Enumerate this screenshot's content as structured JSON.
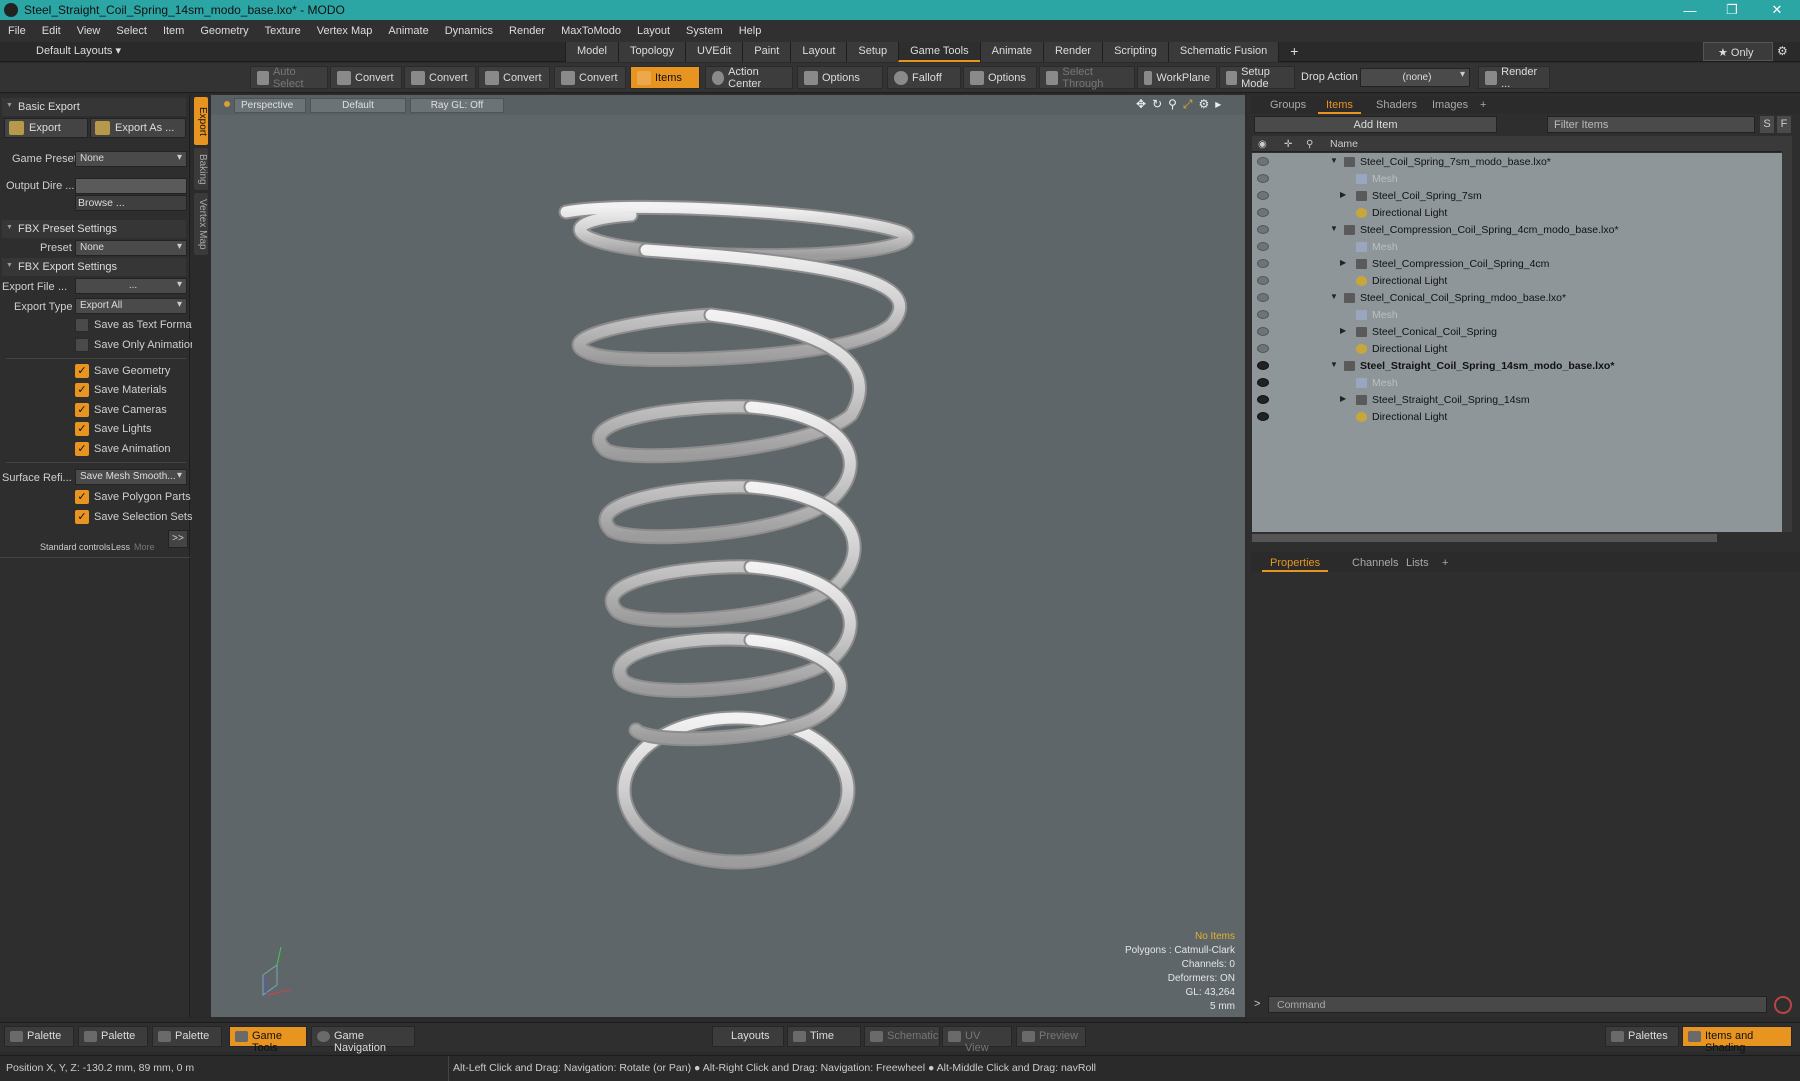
{
  "window": {
    "title": "Steel_Straight_Coil_Spring_14sm_modo_base.lxo* - MODO",
    "controls": [
      "—",
      "❐",
      "✕"
    ]
  },
  "menu": [
    "File",
    "Edit",
    "View",
    "Select",
    "Item",
    "Geometry",
    "Texture",
    "Vertex Map",
    "Animate",
    "Dynamics",
    "Render",
    "MaxToModo",
    "Layout",
    "System",
    "Help"
  ],
  "layouts": {
    "selector": "Default Layouts ▾",
    "tabs": [
      "Model",
      "Topology",
      "UVEdit",
      "Paint",
      "Layout",
      "Setup",
      "Game Tools",
      "Animate",
      "Render",
      "Scripting",
      "Schematic Fusion"
    ],
    "active": "Game Tools",
    "plus": "+",
    "only": "★  Only",
    "gear": "⚙"
  },
  "toolbar": {
    "auto_select": "Auto Select",
    "convert": "Convert",
    "items": "Items",
    "action_center": "Action Center",
    "options": "Options",
    "falloff": "Falloff",
    "select_through": "Select Through",
    "workplane": "WorkPlane",
    "setup_mode": "Setup Mode",
    "drop_action": "Drop Action",
    "drop_value": "(none)",
    "render": "Render ..."
  },
  "left": {
    "vtabs": [
      "Export",
      "Baking",
      "Vertex Map"
    ],
    "basic_export": "Basic Export",
    "export": "Export",
    "export_as": "Export As ...",
    "game_preset_label": "Game Preset",
    "game_preset": "None",
    "output_dir_label": "Output Dire ...",
    "browse": "Browse ...",
    "fbx_preset": "FBX Preset Settings",
    "preset_label": "Preset",
    "preset": "None",
    "fbx_export": "FBX Export Settings",
    "export_file_label": "Export File",
    "export_file": "...",
    "export_file_dots": "...",
    "export_type_label": "Export Type",
    "export_type": "Export All",
    "save_text": "Save as Text Format",
    "save_anim_only": "Save Only Animation",
    "save_geometry": "Save Geometry",
    "save_materials": "Save Materials",
    "save_cameras": "Save Cameras",
    "save_lights": "Save Lights",
    "save_animation": "Save Animation",
    "surface_label": "Surface Refi...",
    "surface": "Save Mesh Smooth...",
    "save_polygon_parts": "Save Polygon Parts",
    "save_selection_sets": "Save Selection Sets",
    "standard": "Standard controls",
    "less": "Less",
    "more": "More",
    "expand": ">>"
  },
  "viewport": {
    "perspective": "Perspective",
    "default": "Default",
    "raygl": "Ray GL: Off",
    "hud": [
      "No Items",
      "Polygons : Catmull-Clark",
      "Channels: 0",
      "Deformers: ON",
      "GL: 43,264",
      "5 mm"
    ]
  },
  "right": {
    "tabs": [
      "Groups",
      "Items",
      "Shaders",
      "Images",
      "+"
    ],
    "active": "Items",
    "add_item": "Add Item",
    "filter": "Filter Items",
    "s": "S",
    "f": "F",
    "name_col": "Name",
    "rows": [
      {
        "label": "Steel_Coil_Spring_7sm_modo_base.lxo*",
        "kind": "scene",
        "eye": false
      },
      {
        "label": "Mesh",
        "kind": "mesh",
        "eye": false
      },
      {
        "label": "Steel_Coil_Spring_7sm",
        "kind": "group",
        "eye": false
      },
      {
        "label": "Directional Light",
        "kind": "light",
        "eye": false
      },
      {
        "label": "Steel_Compression_Coil_Spring_4cm_modo_base.lxo*",
        "kind": "scene",
        "eye": false
      },
      {
        "label": "Mesh",
        "kind": "mesh",
        "eye": false
      },
      {
        "label": "Steel_Compression_Coil_Spring_4cm",
        "kind": "group",
        "eye": false
      },
      {
        "label": "Directional Light",
        "kind": "light",
        "eye": false
      },
      {
        "label": "Steel_Conical_Coil_Spring_mdoo_base.lxo*",
        "kind": "scene",
        "eye": false
      },
      {
        "label": "Mesh",
        "kind": "mesh",
        "eye": false
      },
      {
        "label": "Steel_Conical_Coil_Spring",
        "kind": "group",
        "eye": false
      },
      {
        "label": "Directional Light",
        "kind": "light",
        "eye": false
      },
      {
        "label": "Steel_Straight_Coil_Spring_14sm_modo_base.lxo*",
        "kind": "scene",
        "eye": true,
        "bold": true
      },
      {
        "label": "Mesh",
        "kind": "mesh",
        "eye": true
      },
      {
        "label": "Steel_Straight_Coil_Spring_14sm",
        "kind": "group",
        "eye": true
      },
      {
        "label": "Directional Light",
        "kind": "light",
        "eye": true
      }
    ],
    "props_tabs": [
      "Properties",
      "Channels",
      "Lists",
      "+"
    ],
    "command": "Command",
    "cmd_prompt": ">"
  },
  "bottom": {
    "palette": "Palette",
    "game_tools": "Game Tools",
    "game_nav": "Game Navigation",
    "layouts": "Layouts",
    "time": "Time",
    "schematic": "Schematic",
    "uvview": "UV View",
    "preview": "Preview",
    "palettes": "Palettes",
    "items_shading": "Items and Shading"
  },
  "status": {
    "position": "Position X, Y, Z:   -130.2 mm, 89 mm, 0 m",
    "hint": "Alt-Left Click and Drag: Navigation: Rotate (or Pan) ● Alt-Right Click and Drag: Navigation: Freewheel ● Alt-Middle Click and Drag: navRoll"
  },
  "colors": {
    "accent": "#e89420",
    "titlebar": "#2ba6a4",
    "viewport": "#5e6669"
  }
}
